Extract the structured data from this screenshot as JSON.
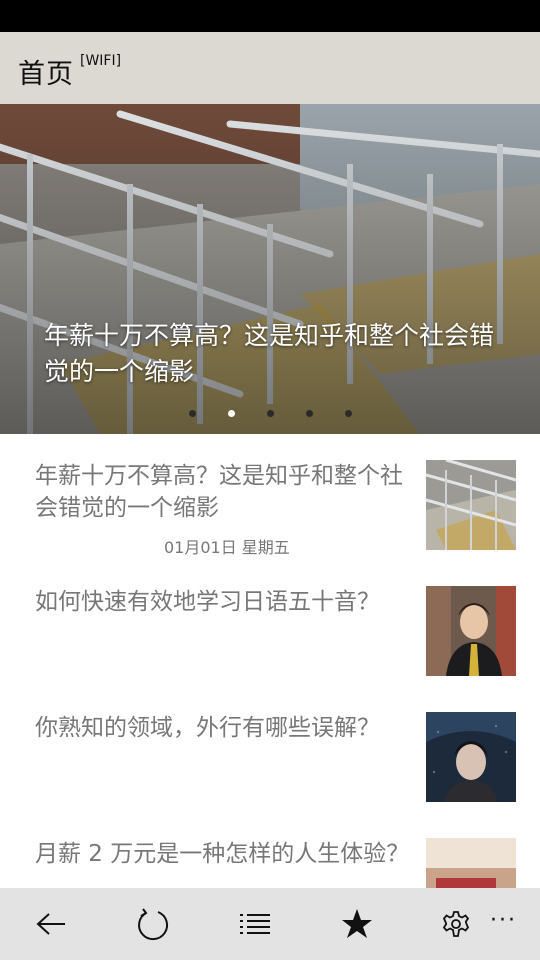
{
  "header": {
    "title": "首页",
    "network": "[WIFI]"
  },
  "hero": {
    "caption": "年薪十万不算高？这是知乎和整个社会错觉的一个缩影",
    "slide_count": 5,
    "active_index": 1
  },
  "articles": [
    {
      "title": "年薪十万不算高？这是知乎和整个社会错觉的一个缩影",
      "date": "01月01日 星期五",
      "thumb": "stairs-thumbnail"
    },
    {
      "title": "如何快速有效地学习日语五十音？",
      "date": "",
      "thumb": "man-in-suit-thumbnail"
    },
    {
      "title": "你熟知的领域，外行有哪些误解？",
      "date": "",
      "thumb": "person-with-umbrella-thumbnail"
    },
    {
      "title": "月薪 2 万元是一种怎样的人生体验？",
      "date": "",
      "thumb": "money-thumbnail"
    }
  ],
  "appbar": {
    "buttons": [
      "back-arrow-icon",
      "refresh-icon",
      "list-icon",
      "star-icon",
      "settings-gear-icon"
    ],
    "more": "···"
  }
}
